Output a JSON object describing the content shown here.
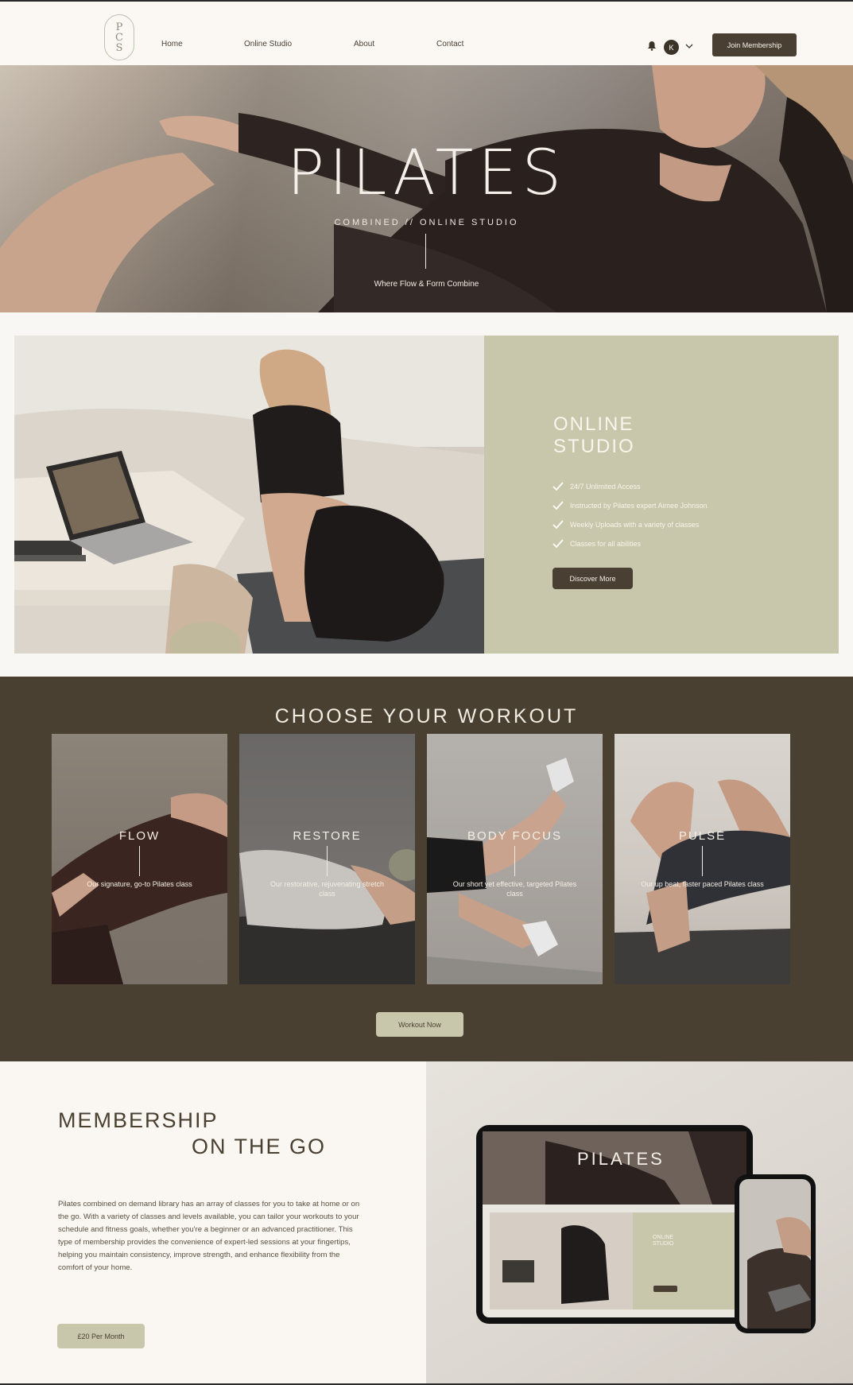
{
  "header": {
    "logo_text": "PCS",
    "nav": [
      "Home",
      "Online Studio",
      "About",
      "Contact"
    ],
    "avatar_initial": "K",
    "join_label": "Join Membership"
  },
  "hero": {
    "title": "PILATES",
    "subtitle": "COMBINED // ONLINE STUDIO",
    "tagline": "Where Flow & Form Combine"
  },
  "online_studio": {
    "title_line1": "ONLINE",
    "title_line2": "STUDIO",
    "features": [
      "24/7 Unlimited Access",
      "Instructed by Pilates expert Aimee Johnson",
      "Weekly Uploads with a variety of classes",
      "Classes for all abilities"
    ],
    "button_label": "Discover More"
  },
  "workouts": {
    "title": "CHOOSE YOUR WORKOUT",
    "cards": [
      {
        "name": "FLOW",
        "desc": "Our signature, go-to Pilates class"
      },
      {
        "name": "RESTORE",
        "desc": "Our restorative, rejuvenating stretch class"
      },
      {
        "name": "BODY FOCUS",
        "desc": "Our short yet effective, targeted Pilates class"
      },
      {
        "name": "PULSE",
        "desc": "Our up beat, faster paced Pilates class"
      }
    ],
    "button_label": "Workout Now"
  },
  "membership": {
    "title_line1": "MEMBERSHIP",
    "title_line2": "ON THE GO",
    "body": "Pilates combined on demand library has an array of classes for you to take at home or on the go. With a variety of classes and levels available, you can tailor your workouts to your schedule and fitness goals, whether you're a beginner or an advanced practitioner. This type of membership provides the convenience of expert-led sessions at your fingertips, helping you maintain consistency, improve strength, and enhance flexibility from the comfort of your home.",
    "price_label": "£20 Per Month",
    "mockup_title": "PILATES",
    "mockup_studio_line1": "ONLINE",
    "mockup_studio_line2": "STUDIO"
  },
  "colors": {
    "brown": "#4a4032",
    "sage": "#c9c7ab",
    "cream": "#faf7f2"
  }
}
